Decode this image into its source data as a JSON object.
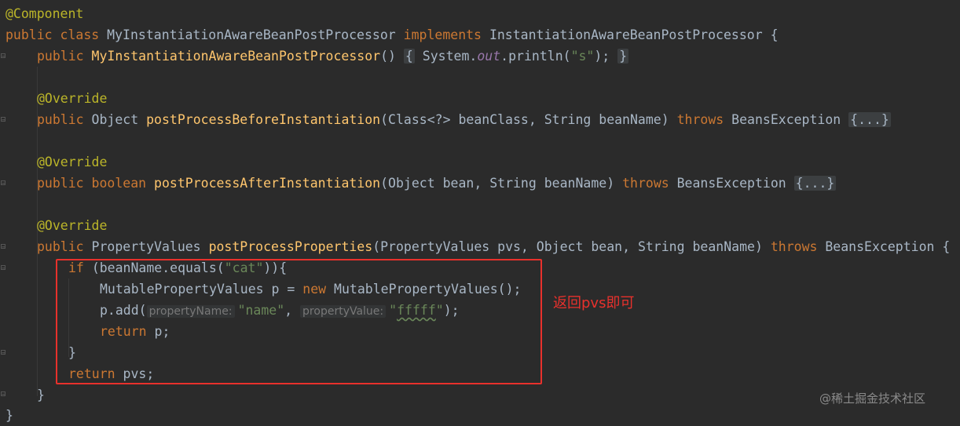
{
  "code": {
    "l1": {
      "annotation": "@Component"
    },
    "l2": {
      "kw_public": "public",
      "kw_class": "class",
      "class_name": "MyInstantiationAwareBeanPostProcessor",
      "kw_implements": "implements",
      "iface": "InstantiationAwareBeanPostProcessor",
      "brace": "{"
    },
    "l3": {
      "kw_public": "public",
      "ctor": "MyInstantiationAwareBeanPostProcessor",
      "parens": "()",
      "fold_open": "{",
      "sys": "System.",
      "out": "out",
      "println": ".println(",
      "str": "\"s\"",
      "end": ");",
      "fold_close": "}"
    },
    "l5": {
      "annotation": "@Override"
    },
    "l6": {
      "kw_public": "public",
      "type": "Object",
      "method": "postProcessBeforeInstantiation",
      "params": "(Class<?> beanClass, String beanName)",
      "kw_throws": "throws",
      "exc": "BeansException",
      "fold": "{...}"
    },
    "l8": {
      "annotation": "@Override"
    },
    "l9": {
      "kw_public": "public",
      "kw_boolean": "boolean",
      "method": "postProcessAfterInstantiation",
      "params": "(Object bean, String beanName)",
      "kw_throws": "throws",
      "exc": "BeansException",
      "fold": "{...}"
    },
    "l11": {
      "annotation": "@Override"
    },
    "l12": {
      "kw_public": "public",
      "type": "PropertyValues",
      "method": "postProcessProperties",
      "params": "(PropertyValues pvs, Object bean, String beanName)",
      "kw_throws": "throws",
      "exc": "BeansException",
      "brace": "{"
    },
    "l13": {
      "kw_if": "if",
      "pre": "(beanName.equals(",
      "str": "\"cat\"",
      "post": ")){"
    },
    "l14": {
      "pre": "MutablePropertyValues p = ",
      "kw_new": "new",
      "post": "MutablePropertyValues();"
    },
    "l15": {
      "pre": "p.add(",
      "hint1": "propertyName:",
      "str1": "\"name\"",
      "comma": ", ",
      "hint2": "propertyValue:",
      "q1": "\"",
      "str2": "fffff",
      "q2": "\"",
      "post": ");"
    },
    "l16": {
      "kw_return": "return",
      "post": "p;"
    },
    "l17": {
      "text": "}"
    },
    "l18": {
      "kw_return": "return",
      "post": "pvs;"
    },
    "l19": {
      "text": "}"
    },
    "l20": {
      "text": "}"
    }
  },
  "annotation_note": "返回pvs即可",
  "watermark": "@稀土掘金技术社区",
  "colors": {
    "background": "#2b2b2b",
    "keyword": "#cc7832",
    "annotation": "#bbb529",
    "method": "#ffc66d",
    "string": "#6a8759",
    "highlight_box": "#e8312c"
  }
}
